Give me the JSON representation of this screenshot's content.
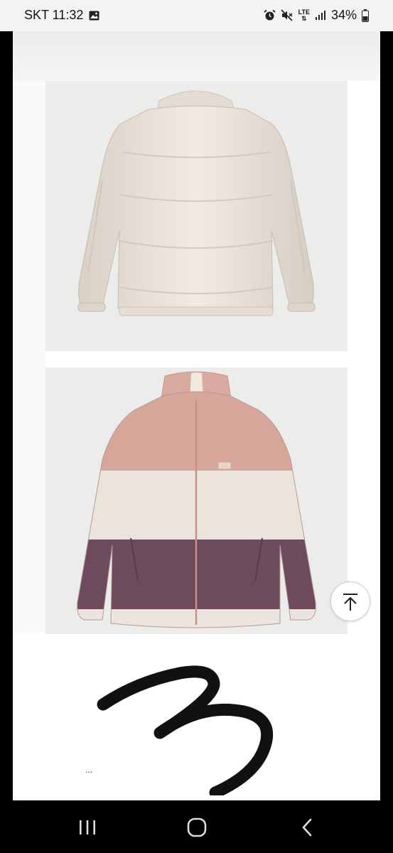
{
  "status_bar": {
    "carrier_time": "SKT 11:32",
    "network": "LTE",
    "battery": "34%",
    "icons": [
      "image-icon",
      "alarm-icon",
      "mute-icon",
      "lte-icon",
      "signal-icon",
      "battery-icon"
    ]
  },
  "products": [
    {
      "name": "cream-puffer-jacket",
      "main_color": "#ece4db"
    },
    {
      "name": "striped-fleece-jacket",
      "stripe_colors": [
        "#d7a89e",
        "#ebe3dc",
        "#6f4b5e"
      ]
    }
  ],
  "scroll_top_icon": "arrow-up-to-line-icon",
  "signature_mark": "handwritten-signature",
  "more_indicator": "...",
  "nav_bar": {
    "buttons": [
      "recent-apps",
      "home",
      "back"
    ]
  }
}
